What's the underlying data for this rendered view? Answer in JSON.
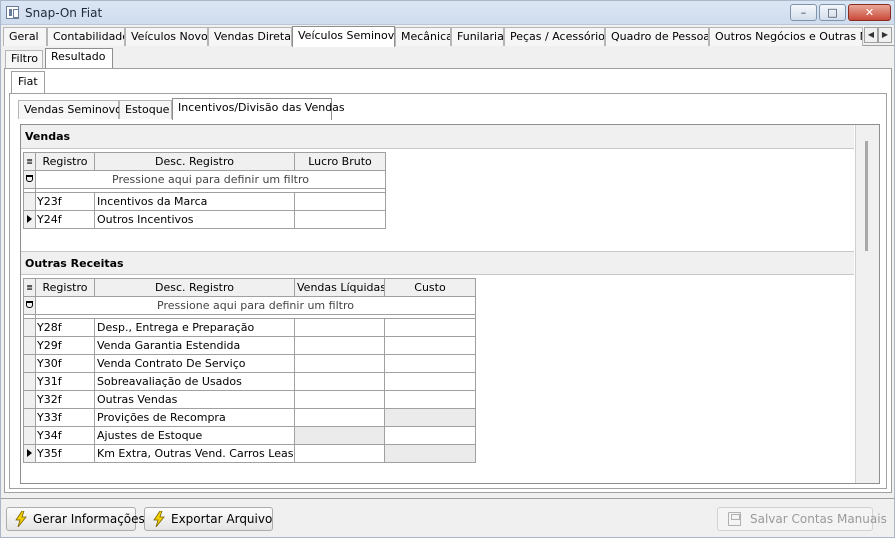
{
  "window": {
    "title": "Snap-On Fiat",
    "controls": {
      "minimize": "–",
      "maximize": "□",
      "close": "✕"
    }
  },
  "main_tabs": [
    "Geral",
    "Contabilidade",
    "Veículos Novos",
    "Vendas Diretas",
    "Veículos Seminovos",
    "Mecânica",
    "Funilaria",
    "Peças / Acessórios",
    "Quadro de Pessoas",
    "Outros Negócios e Outras Mar"
  ],
  "main_tabs_active": "Veículos Seminovos",
  "sub_tabs": [
    "Filtro",
    "Resultado"
  ],
  "sub_tabs_active": "Resultado",
  "brand_tab": "Fiat",
  "inner_tabs": [
    "Vendas Seminovos",
    "Estoque",
    "Incentivos/Divisão das Vendas"
  ],
  "inner_tabs_active": "Incentivos/Divisão das Vendas",
  "vendas": {
    "title": "Vendas",
    "columns": [
      "Registro",
      "Desc. Registro",
      "Lucro Bruto"
    ],
    "filter_text": "Pressione aqui para definir um filtro",
    "rows": [
      {
        "code": "Y23f",
        "desc": "Incentivos da Marca"
      },
      {
        "code": "Y24f",
        "desc": "Outros Incentivos"
      }
    ]
  },
  "outras_receitas": {
    "title": "Outras Receitas",
    "columns": [
      "Registro",
      "Desc. Registro",
      "Vendas Líquidas",
      "Custo"
    ],
    "filter_text": "Pressione aqui para definir um filtro",
    "rows": [
      {
        "code": "Y28f",
        "desc": "Desp., Entrega e Preparação"
      },
      {
        "code": "Y29f",
        "desc": "Venda Garantia Estendida"
      },
      {
        "code": "Y30f",
        "desc": "Venda Contrato De Serviço"
      },
      {
        "code": "Y31f",
        "desc": "Sobreavaliação de Usados"
      },
      {
        "code": "Y32f",
        "desc": "Outras Vendas"
      },
      {
        "code": "Y33f",
        "desc": "Provições de Recompra"
      },
      {
        "code": "Y34f",
        "desc": "Ajustes de Estoque"
      },
      {
        "code": "Y35f",
        "desc": "Km Extra, Outras Vend. Carros Leasing"
      }
    ]
  },
  "buttons": {
    "gerar": "Gerar Informações",
    "exportar": "Exportar Arquivo",
    "salvar": "Salvar Contas Manuais"
  }
}
